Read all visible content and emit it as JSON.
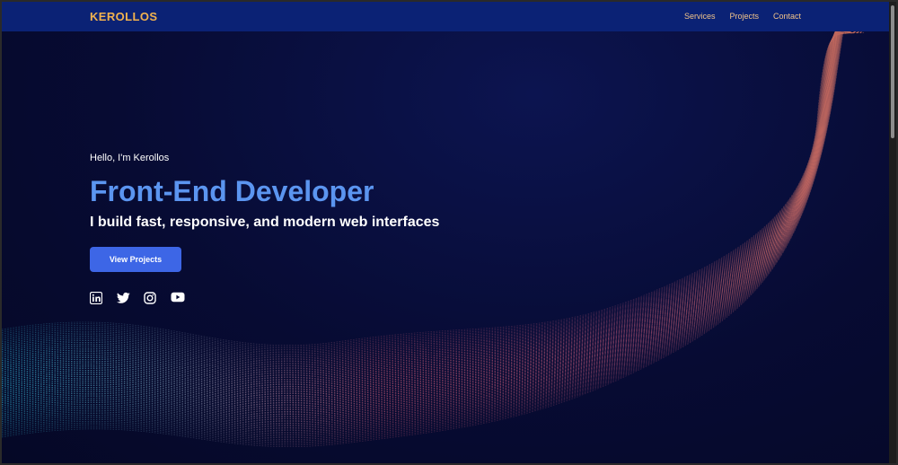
{
  "brand": {
    "logo": "KEROLLOS",
    "accent": "#f2b24e",
    "primary": "#3d66e6",
    "nav_bg": "#0b2275"
  },
  "nav": {
    "links": [
      {
        "label": "Services"
      },
      {
        "label": "Projects"
      },
      {
        "label": "Contact"
      }
    ]
  },
  "hero": {
    "greeting": "Hello, I'm Kerollos",
    "title": "Front-End Developer",
    "subtitle": "I build fast, responsive, and modern web interfaces",
    "cta_label": "View Projects"
  },
  "socials": [
    {
      "icon": "linkedin-icon"
    },
    {
      "icon": "twitter-icon"
    },
    {
      "icon": "instagram-icon"
    },
    {
      "icon": "youtube-icon"
    }
  ]
}
